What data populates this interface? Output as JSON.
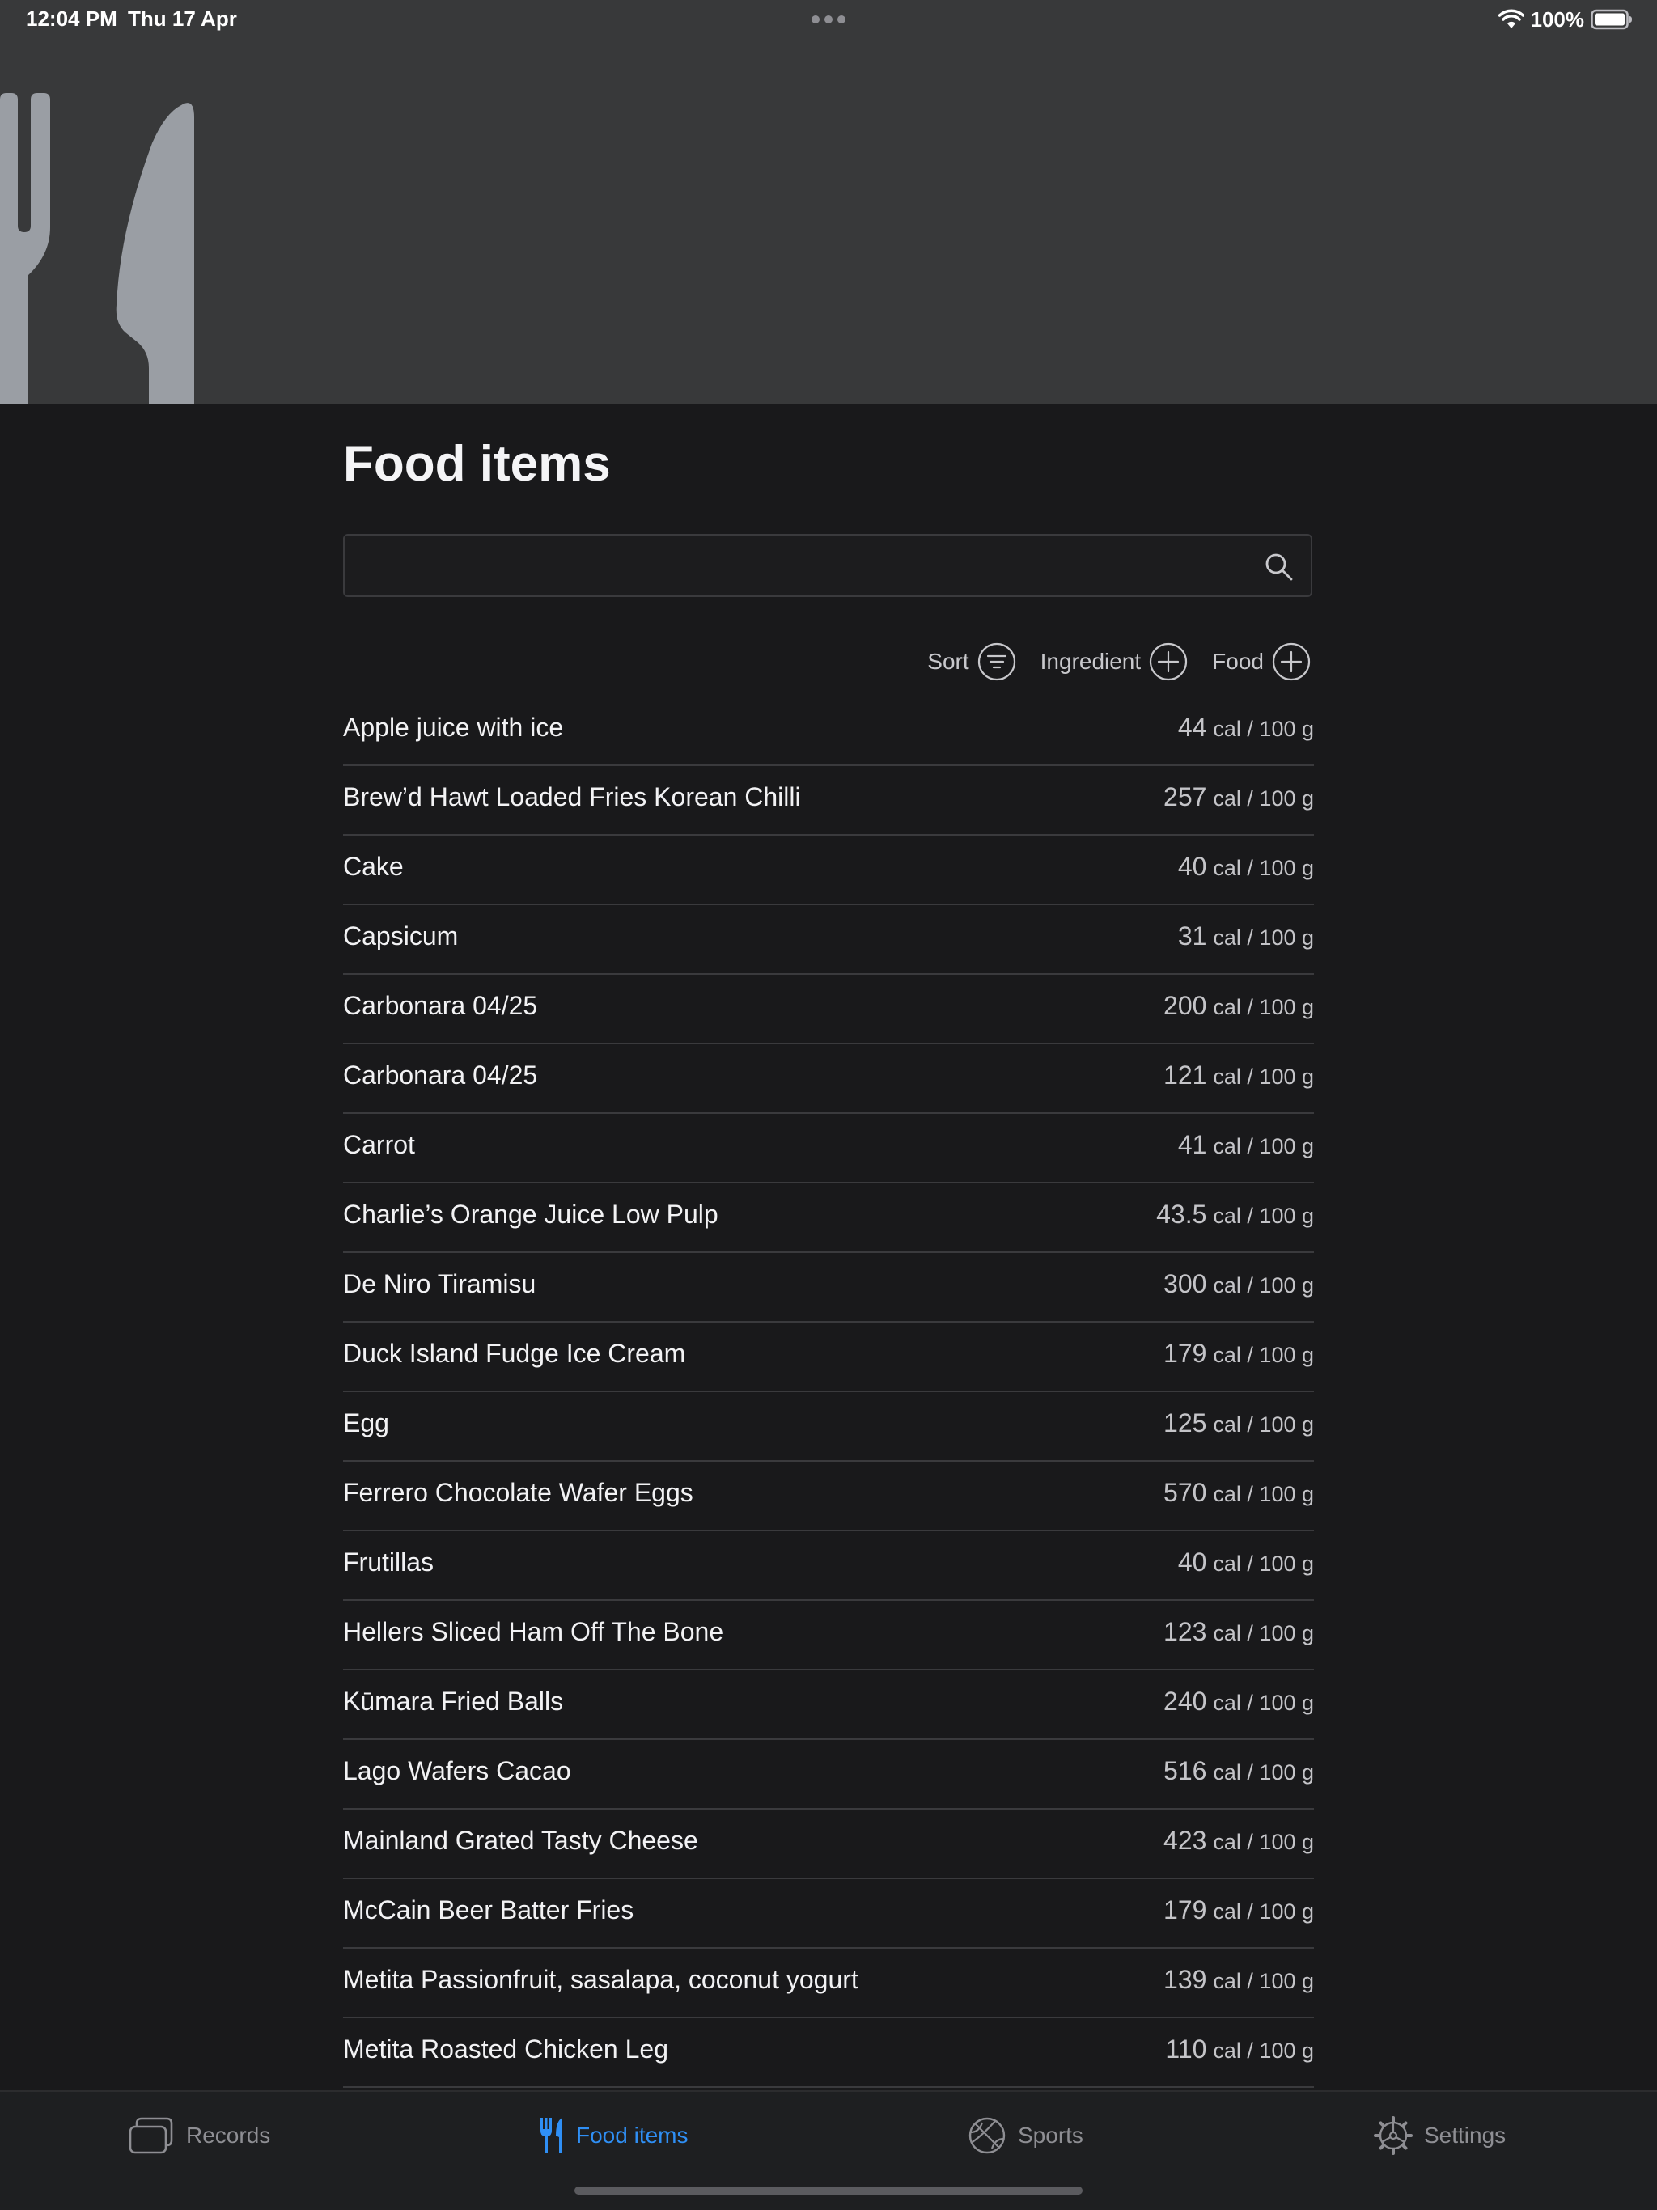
{
  "status_bar": {
    "time": "12:04 PM",
    "date": "Thu 17 Apr",
    "battery": "100%"
  },
  "page": {
    "title": "Food items"
  },
  "search": {
    "placeholder": "",
    "value": ""
  },
  "toolbar": {
    "sort_label": "Sort",
    "ingredient_label": "Ingredient",
    "food_label": "Food"
  },
  "unit_label": "cal / 100 g",
  "food_items": [
    {
      "name": "Apple juice with ice",
      "calories": "44"
    },
    {
      "name": "Brew’d Hawt Loaded Fries Korean Chilli",
      "calories": "257"
    },
    {
      "name": "Cake",
      "calories": "40"
    },
    {
      "name": "Capsicum",
      "calories": "31"
    },
    {
      "name": "Carbonara 04/25",
      "calories": "200"
    },
    {
      "name": "Carbonara 04/25",
      "calories": "121"
    },
    {
      "name": "Carrot",
      "calories": "41"
    },
    {
      "name": "Charlie’s Orange Juice Low Pulp",
      "calories": "43.5"
    },
    {
      "name": "De Niro Tiramisu",
      "calories": "300"
    },
    {
      "name": "Duck Island Fudge Ice Cream",
      "calories": "179"
    },
    {
      "name": "Egg",
      "calories": "125"
    },
    {
      "name": "Ferrero Chocolate Wafer Eggs",
      "calories": "570"
    },
    {
      "name": "Frutillas",
      "calories": "40"
    },
    {
      "name": "Hellers Sliced Ham Off The Bone",
      "calories": "123"
    },
    {
      "name": "Kūmara Fried Balls",
      "calories": "240"
    },
    {
      "name": "Lago Wafers Cacao",
      "calories": "516"
    },
    {
      "name": "Mainland Grated Tasty Cheese",
      "calories": "423"
    },
    {
      "name": "McCain Beer Batter Fries",
      "calories": "179"
    },
    {
      "name": "Metita Passionfruit, sasalapa, coconut yogurt",
      "calories": "139"
    },
    {
      "name": "Metita Roasted Chicken Leg",
      "calories": "110"
    }
  ],
  "tab_bar": {
    "tabs": [
      {
        "label": "Records",
        "icon": "records-icon"
      },
      {
        "label": "Food items",
        "icon": "fork-knife-icon"
      },
      {
        "label": "Sports",
        "icon": "basketball-icon"
      },
      {
        "label": "Settings",
        "icon": "gear-icon"
      }
    ],
    "active_tab": "Food items"
  },
  "colors": {
    "accent": "#2f8ff5",
    "background": "#19191b",
    "header_background": "#38393a",
    "hero_icon": "#9a9ea4"
  }
}
